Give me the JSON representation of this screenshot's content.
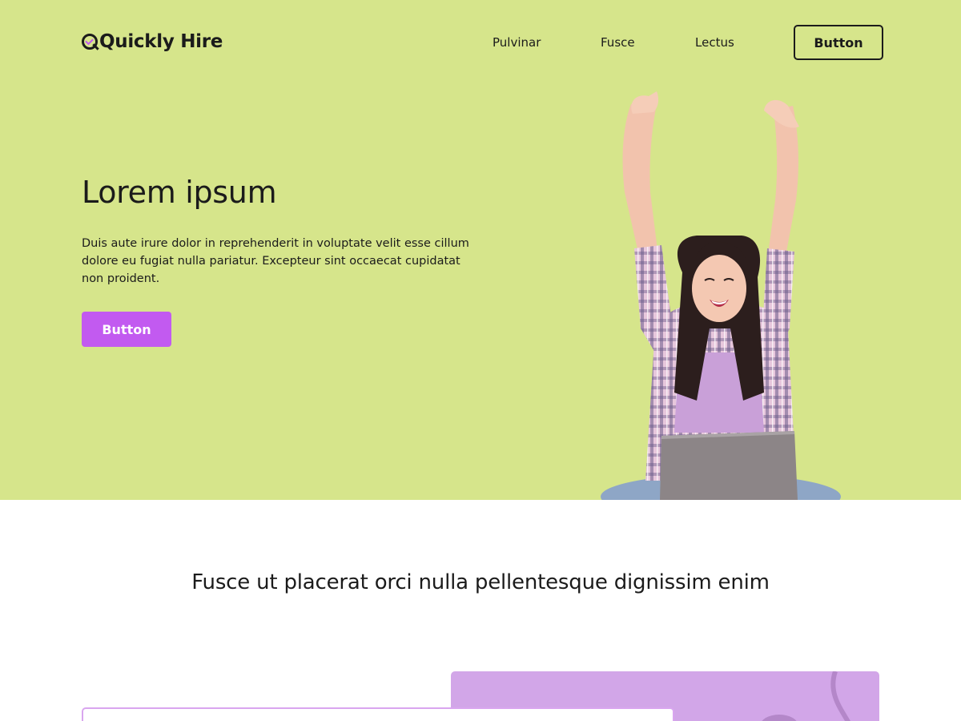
{
  "brand": {
    "name": "Quickly Hire",
    "accent": "#c25af0"
  },
  "colors": {
    "hero_bg": "#d6e58b",
    "card_purple": "#d2a6e8",
    "text": "#1b1b1b"
  },
  "nav": {
    "items": [
      {
        "label": "Pulvinar"
      },
      {
        "label": "Fusce"
      },
      {
        "label": "Lectus"
      }
    ],
    "cta_label": "Button"
  },
  "hero": {
    "title": "Lorem ipsum",
    "text": "Duis aute irure dolor in reprehenderit in voluptate velit esse cillum dolore eu fugiat nulla pariatur. Excepteur sint occaecat cupidatat non proident.",
    "button_label": "Button"
  },
  "section": {
    "title": "Fusce ut placerat orci nulla pellentesque dignissim enim"
  }
}
